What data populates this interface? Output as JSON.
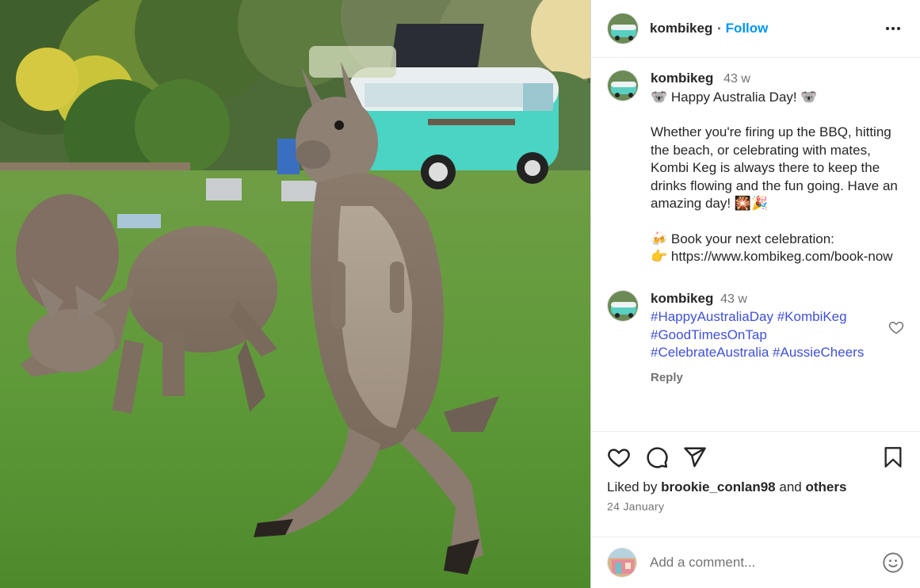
{
  "post": {
    "username": "kombikeg",
    "follow_label": "Follow",
    "more_label": "•••",
    "photo_alt": "Kangaroos on grass with a turquoise Kombi van in the background"
  },
  "caption": {
    "username": "kombikeg",
    "time": "43 w",
    "line1": "🐨 Happy Australia Day! 🐨",
    "line2": "Whether you're firing up the BBQ, hitting the beach, or celebrating with mates, Kombi Keg is always there to keep the drinks flowing and the fun going. Have an amazing day! 🎇🎉",
    "line3": "🍻 Book your next celebration:",
    "line4": "👉 https://www.kombikeg.com/book-now"
  },
  "comment": {
    "username": "kombikeg",
    "time": "43 w",
    "tags": [
      "#HappyAustraliaDay",
      "#KombiKeg",
      "#GoodTimesOnTap",
      "#CelebrateAustralia",
      "#AussieCheers"
    ],
    "reply_label": "Reply"
  },
  "engagement": {
    "liked_by_prefix": "Liked by",
    "liked_by_user": "brookie_conlan98",
    "liked_by_and": "and",
    "liked_by_others": "others",
    "date": "24 January"
  },
  "add_comment": {
    "placeholder": "Add a comment..."
  },
  "icons": {
    "like": "heart-icon",
    "comment": "comment-icon",
    "share": "share-icon",
    "save": "bookmark-icon",
    "emoji": "emoji-icon",
    "more": "more-icon"
  },
  "colors": {
    "follow": "#0095f6",
    "hashtag": "#3f51d6",
    "muted": "#737373",
    "text": "#262626"
  }
}
